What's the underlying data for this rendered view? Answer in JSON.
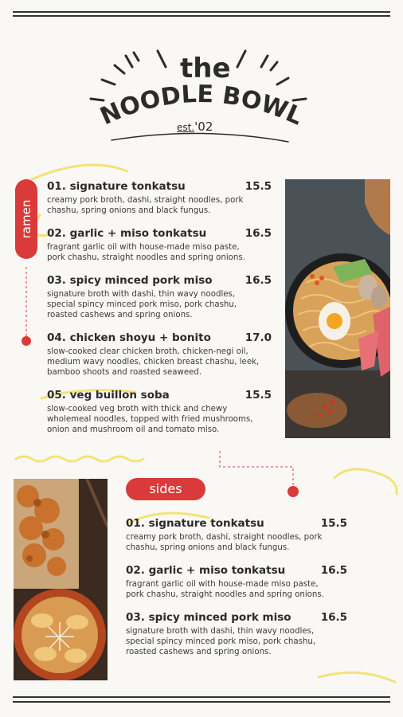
{
  "brand": {
    "the": "the",
    "name": "NOODLE BOWL",
    "est_prefix": "est.",
    "est_year": "'02"
  },
  "ramen": {
    "label": "ramen",
    "items": [
      {
        "name": "01. signature tonkatsu",
        "price": "15.5",
        "desc": [
          "creamy pork broth, dashi, straight noodles, pork",
          "chashu, spring onions and black fungus."
        ]
      },
      {
        "name": "02. garlic + miso tonkatsu",
        "price": "16.5",
        "desc": [
          "fragrant garlic oil with house-made miso paste,",
          "pork chashu, straight noodles and spring onions."
        ]
      },
      {
        "name": "03. spicy minced pork miso",
        "price": "16.5",
        "desc": [
          "signature broth with dashi, thin wavy noodles,",
          "special spincy minced pork miso, pork chashu,",
          "roasted cashews and spring onions."
        ]
      },
      {
        "name": "04. chicken shoyu + bonito",
        "price": "17.0",
        "desc": [
          "slow-cooked clear chicken broth, chicken-negi oil,",
          "medium wavy noodles, chicken breast chashu, leek,",
          "bamboo shoots and roasted seaweed."
        ]
      },
      {
        "name": "05. veg buillon soba",
        "price": "15.5",
        "desc": [
          "slow-cooked veg broth with thick and chewy",
          "wholemeal noodles, topped with fried mushrooms,",
          "onion and mushroom oil and tomato miso."
        ]
      }
    ]
  },
  "sides": {
    "label": "sides",
    "items": [
      {
        "name": "01. signature tonkatsu",
        "price": "15.5",
        "desc": [
          "creamy pork broth, dashi, straight noodles, pork",
          "chashu, spring onions and black fungus."
        ]
      },
      {
        "name": "02. garlic + miso tonkatsu",
        "price": "16.5",
        "desc": [
          "fragrant garlic oil with house-made miso paste,",
          "pork chashu, straight noodles and spring onions."
        ]
      },
      {
        "name": "03. spicy minced pork miso",
        "price": "16.5",
        "desc": [
          "signature broth with dashi, thin wavy noodles,",
          "special spincy minced pork miso, pork chashu,",
          "roasted cashews and spring onions."
        ]
      }
    ]
  },
  "colors": {
    "accent": "#d93a3a",
    "highlight": "#f4e27a",
    "ink": "#2b2b2b",
    "background": "#faf8f4"
  }
}
